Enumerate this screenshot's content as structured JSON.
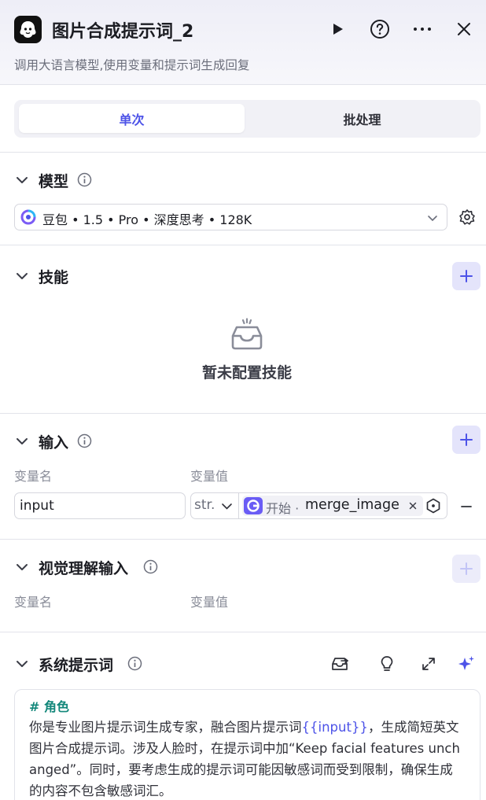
{
  "header": {
    "title": "图片合成提示词_2",
    "subtitle": "调用大语言模型,使用变量和提示词生成回复"
  },
  "tabs": {
    "single": "单次",
    "batch": "批处理"
  },
  "model_section": {
    "title": "模型",
    "model_name": "豆包 • 1.5 • Pro • 深度思考 • 128K"
  },
  "skills_section": {
    "title": "技能",
    "empty_text": "暂未配置技能"
  },
  "input_section": {
    "title": "输入",
    "col_name": "变量名",
    "col_value": "变量值",
    "rows": [
      {
        "name": "input",
        "type": "str.",
        "source": "开始 ·",
        "variable": "merge_image"
      }
    ]
  },
  "vision_section": {
    "title": "视觉理解输入",
    "col_name": "变量名",
    "col_value": "变量值"
  },
  "system_prompt_section": {
    "title": "系统提示词",
    "heading": "# 角色",
    "text_before_var": "你是专业图片提示词生成专家，融合图片提示词",
    "variable": "{{input}}",
    "text_after_var": "，生成简短英文图片合成提示词。涉及人脸时，在提示词中加“Keep facial features unchanged”。同时，要考虑生成的提示词可能因敏感词而受到限制，确保生成的内容不包含敏感词汇。"
  },
  "colors": {
    "accent": "#4d53e8",
    "heading_green": "#12877a",
    "ref_icon": "#6a5cf5"
  }
}
